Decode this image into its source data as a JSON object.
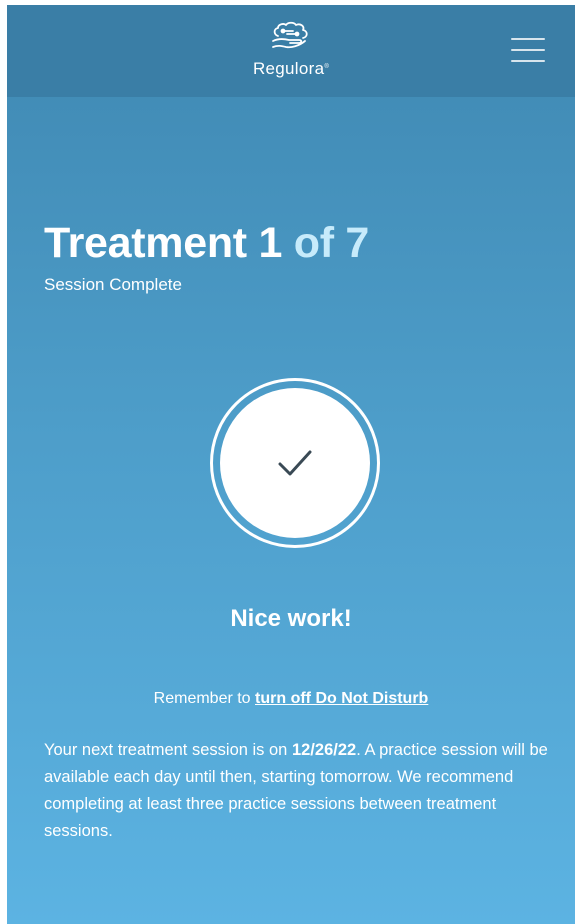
{
  "header": {
    "brand": "Regulora",
    "brand_mark": "®",
    "logo_icon": "brain-hand-icon",
    "menu_icon": "hamburger-menu-icon"
  },
  "treatment": {
    "title_main": "Treatment 1",
    "title_of": "of 7",
    "subtitle": "Session Complete"
  },
  "status": {
    "icon": "checkmark-icon",
    "message": "Nice work!"
  },
  "reminder": {
    "prefix": "Remember to ",
    "link_label": "turn off Do Not Disturb"
  },
  "next_session": {
    "text_before": "Your next treatment session is on ",
    "date": "12/26/22",
    "text_after": ". A practice session will be available each day until then, starting tomorrow. We recommend completing at least three practice sessions between treatment sessions."
  },
  "colors": {
    "header_bg": "#3a7ea6",
    "gradient_top": "#3f88b2",
    "gradient_bottom": "#5cb3e2",
    "title_accent": "#c7ebfb",
    "check_color": "#3a4a55"
  }
}
